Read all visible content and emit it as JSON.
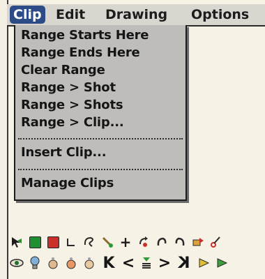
{
  "menubar": {
    "menus": [
      {
        "label": "Clip"
      },
      {
        "label": "Edit"
      },
      {
        "label": "Drawing"
      },
      {
        "label": "Options"
      }
    ]
  },
  "clip_menu": {
    "items": [
      {
        "label": "Range Starts Here"
      },
      {
        "label": "Range Ends Here"
      },
      {
        "label": "Clear Range"
      },
      {
        "label": "Range > Shot"
      },
      {
        "label": "Range > Shots"
      },
      {
        "label": "Range > Clip..."
      },
      {
        "label": "Insert Clip..."
      },
      {
        "label": "Manage Clips"
      }
    ]
  },
  "toolbar": {
    "row1_icons": [
      "select-arrow-icon",
      "green-square-icon",
      "red-square-icon",
      "corner-icon",
      "lasso-icon",
      "brush-icon",
      "crosshair-icon",
      "rotate-icon",
      "undo-curve-icon",
      "redo-curve-icon",
      "move-icon",
      "cut-icon"
    ],
    "row2_icons": [
      "eye-icon",
      "bulb-icon",
      "onion-skin-icon",
      "onion-skin-2-icon",
      "onion-skin-3-icon",
      "first-frame-icon",
      "prev-frame-icon",
      "current-frame-icon",
      "next-frame-icon",
      "last-frame-icon",
      "play-icon",
      "loop-icon"
    ],
    "nav_glyphs": {
      "first": "K",
      "prev": "<",
      "next": ">",
      "last": "K"
    }
  }
}
